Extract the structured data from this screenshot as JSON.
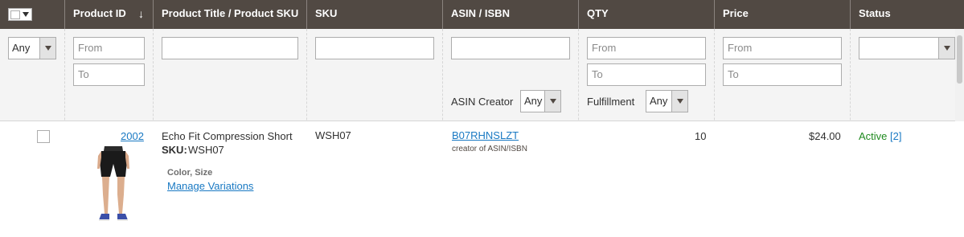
{
  "header": {
    "columns": {
      "product_id": "Product ID",
      "title_sku": "Product Title / Product SKU",
      "sku": "SKU",
      "asin": "ASIN / ISBN",
      "qty": "QTY",
      "price": "Price",
      "status": "Status"
    },
    "sort_indicator": "↓"
  },
  "filters": {
    "massaction_select": "Any",
    "product_id_from_placeholder": "From",
    "product_id_to_placeholder": "To",
    "title_value": "",
    "sku_value": "",
    "asin_value": "",
    "asin_creator_label": "ASIN Creator",
    "asin_creator_value": "Any",
    "qty_from_placeholder": "From",
    "qty_to_placeholder": "To",
    "fulfillment_label": "Fulfillment",
    "fulfillment_value": "Any",
    "price_from_placeholder": "From",
    "price_to_placeholder": "To",
    "status_value": ""
  },
  "rows": [
    {
      "product_id": "2002",
      "title": "Echo Fit Compression Short",
      "sku_label": "SKU:",
      "sku_inline": "WSH07",
      "attributes": "Color, Size",
      "manage_variations": "Manage Variations",
      "sku": "WSH07",
      "asin": "B07RHNSLZT",
      "asin_note": "creator of ASIN/ISBN",
      "qty": "10",
      "price": "$24.00",
      "status": "Active",
      "status_count": "[2]"
    }
  ],
  "colors": {
    "header_bg": "#514943",
    "filter_bg": "#f4f4f4",
    "link": "#1979c3",
    "active_status": "#1f8a1f"
  }
}
